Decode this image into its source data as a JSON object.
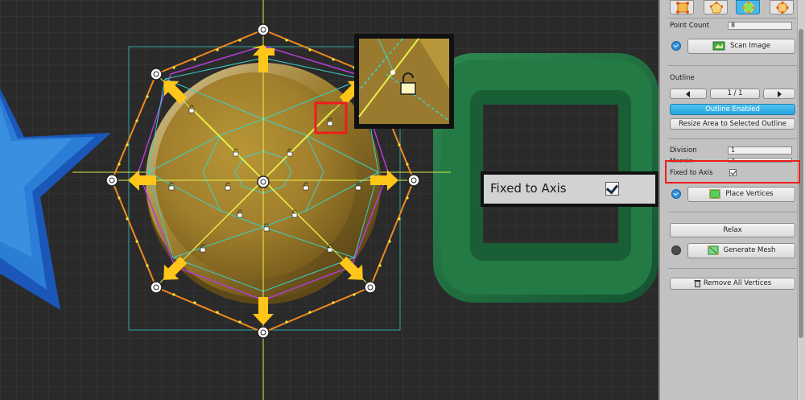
{
  "toolbar": {
    "tools": [
      {
        "name": "edit-area-tool",
        "active": false
      },
      {
        "name": "outline-tool",
        "active": false
      },
      {
        "name": "vertex-tool",
        "active": true
      },
      {
        "name": "mesh-tool",
        "active": false
      }
    ]
  },
  "panel": {
    "point_count_label": "Point Count",
    "point_count_value": "8",
    "scan_image_label": "Scan Image",
    "outline_heading": "Outline",
    "outline_pager": "1 / 1",
    "outline_enabled_label": "Outline Enabled",
    "resize_area_label": "Resize Area to Selected Outline",
    "division_label": "Division",
    "division_value": "1",
    "margin_label": "Margin",
    "margin_value": "2",
    "fixed_to_axis_label": "Fixed to Axis",
    "fixed_to_axis_checked": true,
    "place_vertices_label": "Place Vertices",
    "relax_label": "Relax",
    "generate_mesh_label": "Generate Mesh",
    "remove_all_vertices_label": "Remove All Vertices"
  },
  "callout": {
    "fixed_to_axis_label": "Fixed to Axis",
    "checked": true
  },
  "colors": {
    "accent_blue": "#2ba3dc",
    "highlight_red": "#ee1c1c",
    "outline_orange": "#f08a1e",
    "arrow_yellow": "#ffc61a",
    "mesh_yellow": "#e8f04a",
    "mesh_cyan": "#3ad2c8",
    "margin_magenta": "#b43cd8",
    "sprite_gold": "#9a7a2e",
    "sprite_green": "#1f6e3c",
    "sprite_blue": "#1e6fc4"
  }
}
